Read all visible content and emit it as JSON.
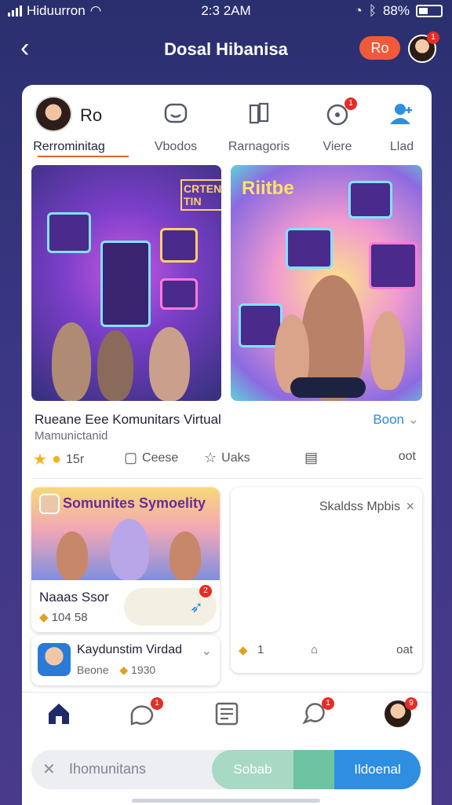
{
  "status": {
    "carrier": "Hiduurron",
    "time": "2:3 2AM",
    "battery": "88%"
  },
  "header": {
    "title": "Dosal Hibanisa",
    "badge": "Ro",
    "avatar_notif": "1"
  },
  "profile": {
    "name": "Ro"
  },
  "tabs": [
    {
      "label": "Rerrominitag",
      "icon": "user-icon"
    },
    {
      "label": "Vbodos",
      "icon": "chat-icon"
    },
    {
      "label": "Rarnagoris",
      "icon": "book-icon"
    },
    {
      "label": "Viere",
      "icon": "target-icon"
    },
    {
      "label": "Llad",
      "icon": "person-icon"
    }
  ],
  "feed": {
    "image1_caption": "CRTEND TIN",
    "image2_caption": "Riitbe",
    "post_title": "Rueane Eee Komunitars Virtual",
    "post_sub": "Mamunictanid",
    "boon": "Boon",
    "likes": "15r",
    "comment_label": "Ceese",
    "share_label": "Uaks",
    "stat": "oot"
  },
  "cards": {
    "mini_head": "Somunites Symoelity",
    "mini_label": "Naaas Ssor",
    "mini_meta": "104 58",
    "mini_notif": "2",
    "mini2_title": "Kaydunstim Virdad",
    "mini2_meta": "Beone",
    "mini2_count": "1930",
    "side_head": "Skaldss Mpbis",
    "side_count": "1",
    "side_stat": "oat"
  },
  "bottomnav": {
    "chat_notif": "1",
    "msg_notif": "1",
    "avatar_notif": "9"
  },
  "search": {
    "placeholder": "Ihomunitans",
    "btn1": "Sobab",
    "btn2": "Ildoenal"
  }
}
